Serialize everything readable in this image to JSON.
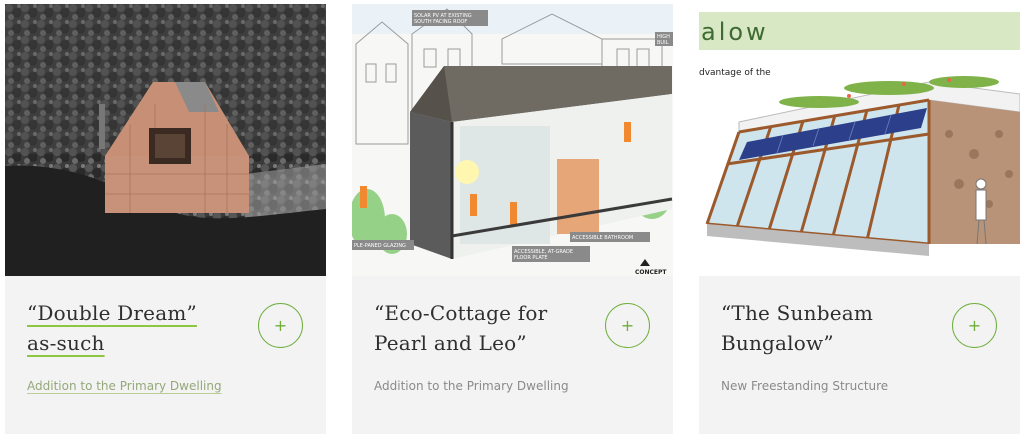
{
  "cards": [
    {
      "title": "“Double Dream” as-such",
      "title_line1": "“Double Dream”",
      "title_line2": "as-such",
      "subtitle": "Addition to the Primary Dwelling",
      "button_symbol": "+",
      "image_alt": "Small copper-clad house among dark trees"
    },
    {
      "title": "“Eco-Cottage for Pearl and Leo”",
      "subtitle": "Addition to the Primary Dwelling",
      "button_symbol": "+",
      "image_labels": {
        "solar": "SOLAR PV AT EXISTING SOUTH FACING ROOF",
        "high": "HIGH BUIL",
        "glazing": "PLE-PANED GLAZING",
        "bathroom": "ACCESSIBLE BATHROOM",
        "floor": "ACCESSIBLE, AT-GRADE FLOOR PLATE",
        "concept": "CONCEPT"
      }
    },
    {
      "title": "“The Sunbeam Bungalow”",
      "subtitle": "New Freestanding Structure",
      "button_symbol": "+",
      "image_labels": {
        "banner": "alow",
        "caption": "dvantage of the"
      }
    }
  ],
  "colors": {
    "accent": "#6fae3d",
    "card_bg": "#f3f3f3",
    "title": "#2f2f2f",
    "subtitle": "#8a8a8a"
  },
  "icons": [
    "plus-icon"
  ]
}
